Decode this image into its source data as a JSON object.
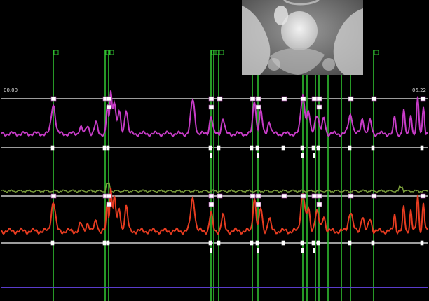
{
  "timeline": {
    "start_time": "00.00",
    "end_time": "06.22"
  },
  "colors": {
    "background": "#000000",
    "baseline": "#cfcfcf",
    "event_line": "#2fbf2f",
    "upper_trace": "#c83cc8",
    "middle_trace": "#7ca03c",
    "lower_trace": "#e83c20",
    "bottom_trace": "#5a3ccc",
    "marker_fill": "#ffffff"
  },
  "fluoroscopy": {
    "icon": "pelvis-xray-image",
    "description_visible": false
  },
  "traces": {
    "upper": "pressure-trace-1",
    "middle": "pressure-trace-2",
    "lower": "pressure-trace-3",
    "bottom": "pressure-trace-4"
  }
}
